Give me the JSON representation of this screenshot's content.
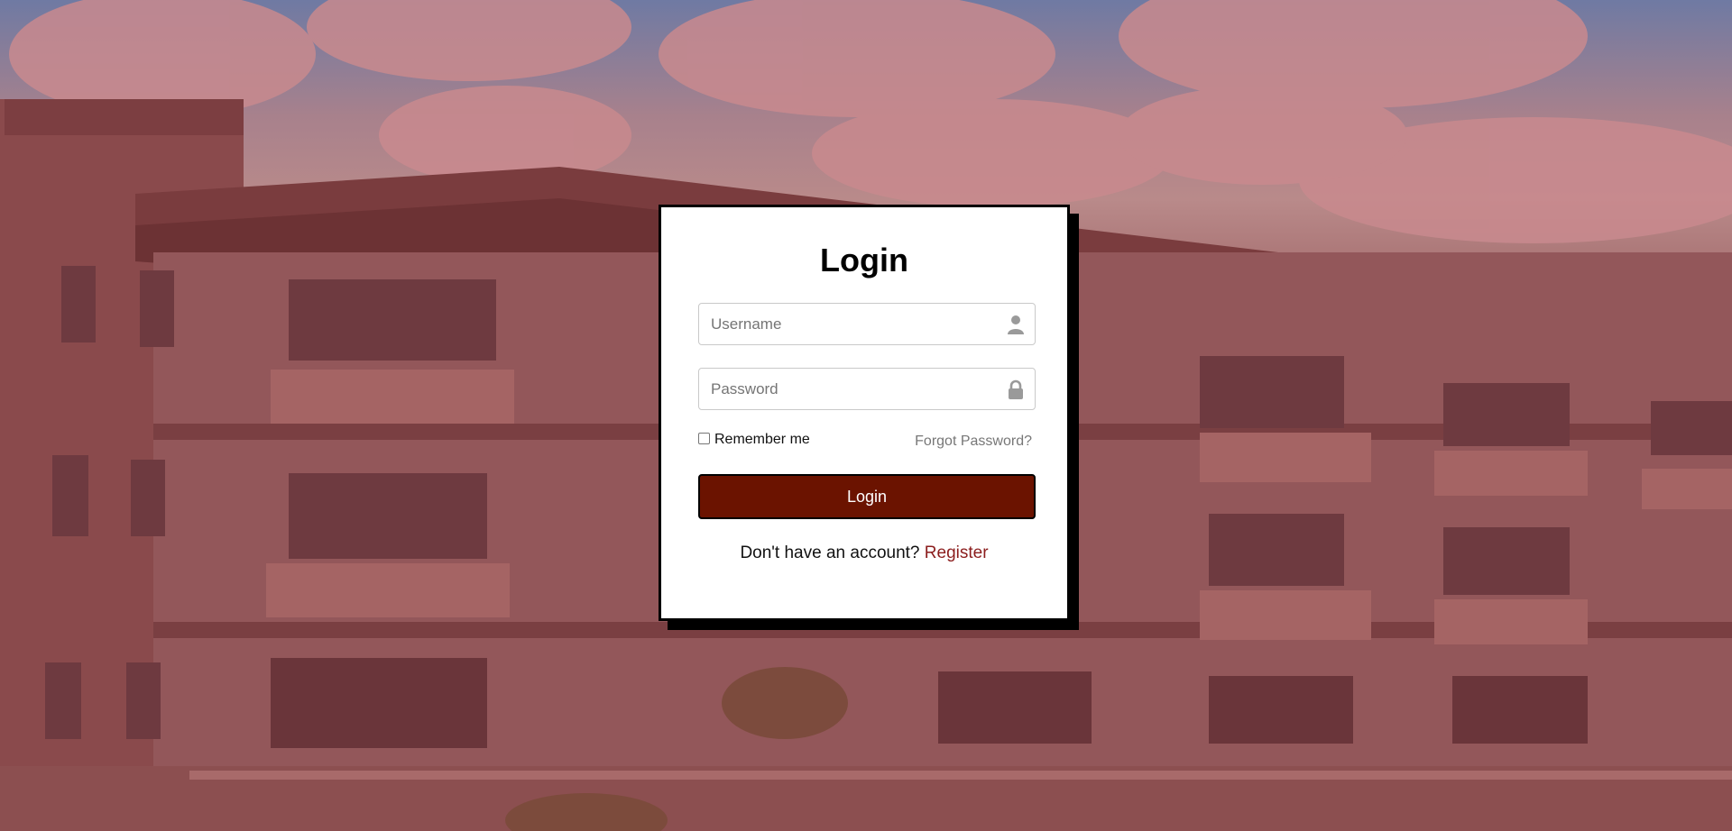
{
  "login": {
    "title": "Login",
    "username_placeholder": "Username",
    "password_placeholder": "Password",
    "remember_label": "Remember me",
    "forgot_label": "Forgot Password?",
    "button_label": "Login",
    "no_account_text": "Don't have an account?",
    "register_label": "Register"
  },
  "icons": {
    "username": "user-icon",
    "password": "lock-icon"
  },
  "colors": {
    "button_bg": "#6b1300",
    "register_link": "#8b1d1d",
    "forgot_link": "#777777",
    "background_tint": "#9b5f60"
  }
}
